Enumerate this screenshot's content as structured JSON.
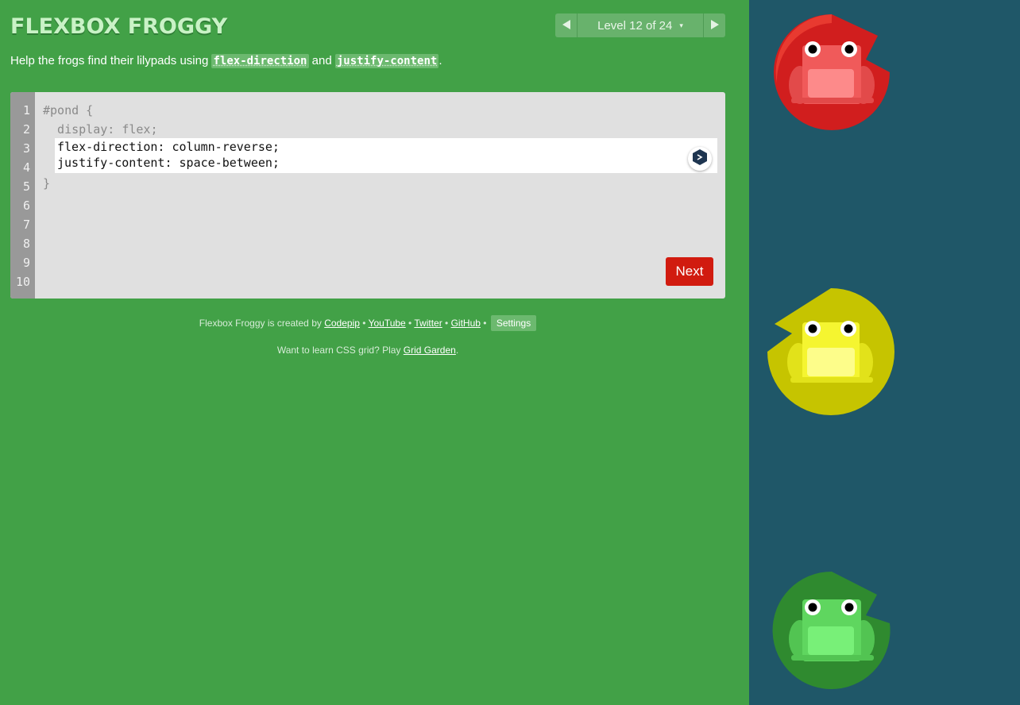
{
  "app": {
    "title": "FLEXBOX FROGGY"
  },
  "level_nav": {
    "prev_icon": "triangle-left-icon",
    "level_text": "Level 12 of 24",
    "dropdown_caret": "▾",
    "next_icon": "triangle-right-icon"
  },
  "instructions": {
    "prefix": "Help the frogs find their lilypads using ",
    "prop1": "flex-direction",
    "middle": " and ",
    "prop2": "justify-content",
    "suffix": "."
  },
  "editor": {
    "line_numbers": [
      "1",
      "2",
      "3",
      "4",
      "5",
      "6",
      "7",
      "8",
      "9",
      "10"
    ],
    "line1": "#pond {",
    "line2": "  display: flex;",
    "input_value": "flex-direction: column-reverse;\njustify-content: space-between;",
    "line5": "}",
    "extension_icon": "dark-hexagon-extension-icon",
    "next_label": "Next"
  },
  "footer": {
    "credit_prefix": "Flexbox Froggy is created by ",
    "codepip": "Codepip",
    "sep": " • ",
    "youtube": "YouTube",
    "twitter": "Twitter",
    "github": "GitHub",
    "settings": "Settings",
    "grid_prefix": "Want to learn CSS grid? Play ",
    "grid_link": "Grid Garden",
    "grid_suffix": "."
  },
  "pond": {
    "frogs": [
      {
        "color": "red",
        "pad_color": "#d11e1e",
        "frog_color": "#f05a5a"
      },
      {
        "color": "yellow",
        "pad_color": "#c6c400",
        "frog_color": "#f5f530"
      },
      {
        "color": "green",
        "pad_color": "#2f8a2f",
        "frog_color": "#5fd65f"
      }
    ]
  },
  "colors": {
    "background": "#42a147",
    "pond": "#1f5768",
    "next_button": "#d11b0f"
  }
}
